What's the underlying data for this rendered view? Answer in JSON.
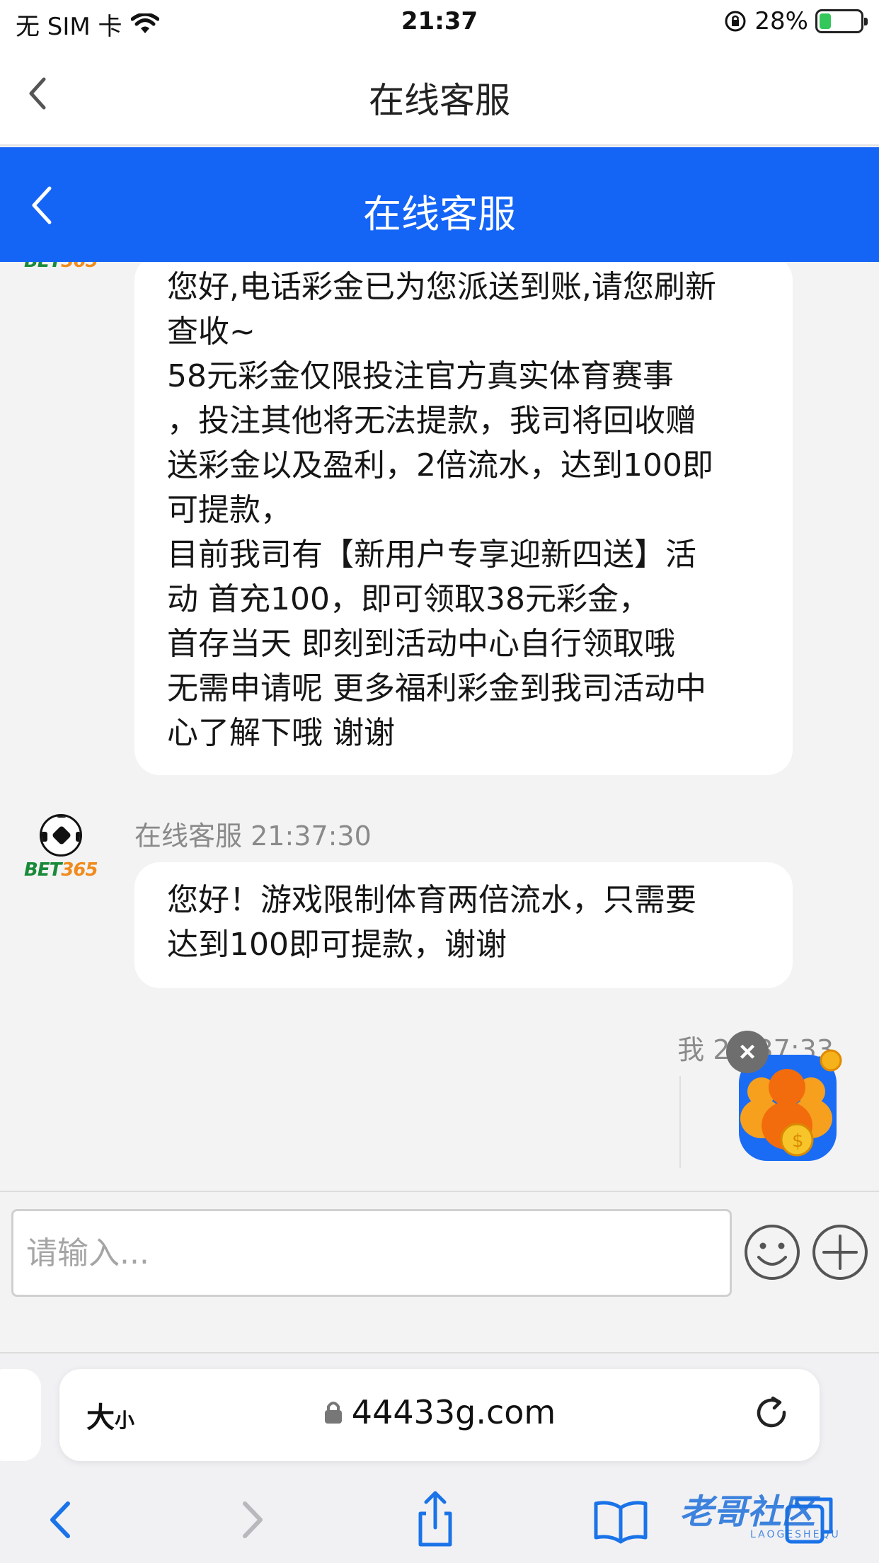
{
  "status_bar": {
    "carrier": "无 SIM 卡",
    "time": "21:37",
    "battery": "28%",
    "battery_level": 0.28
  },
  "page_title": "在线客服",
  "chat": {
    "header_title": "在线客服",
    "messages": [
      {
        "text": "您好,电话彩金已为您派送到账,请您刷新\n查收~\n58元彩金仅限投注官方真实体育赛事\n，投注其他将无法提款，我司将回收赠\n送彩金以及盈利，2倍流水，达到100即\n可提款，\n目前我司有【新用户专享迎新四送】活\n动 首充100，即可领取38元彩金，\n首存当天 即刻到活动中心自行领取哦\n无需申请呢 更多福利彩金到我司活动中\n心了解下哦 谢谢"
      },
      {
        "sender": "在线客服",
        "time": "21:37:30",
        "text": "您好！游戏限制体育两倍流水，只需要\n达到100即可提款，谢谢"
      },
      {
        "sender": "我",
        "time": "21:37:33"
      }
    ],
    "avatar_brand_main": "BET",
    "avatar_brand_accent": "365",
    "promo_close": "×"
  },
  "input": {
    "placeholder": "请输入..."
  },
  "safari": {
    "text_size_big": "大",
    "text_size_small": "小",
    "url": "44433g.com"
  },
  "watermark": {
    "text": "老哥社区",
    "sub": "LAOGESHEQU"
  },
  "colors": {
    "header_blue": "#1464f6",
    "bubble": "#ffffff",
    "background": "#f3f3f3",
    "safari_tint": "#1a73e8"
  }
}
